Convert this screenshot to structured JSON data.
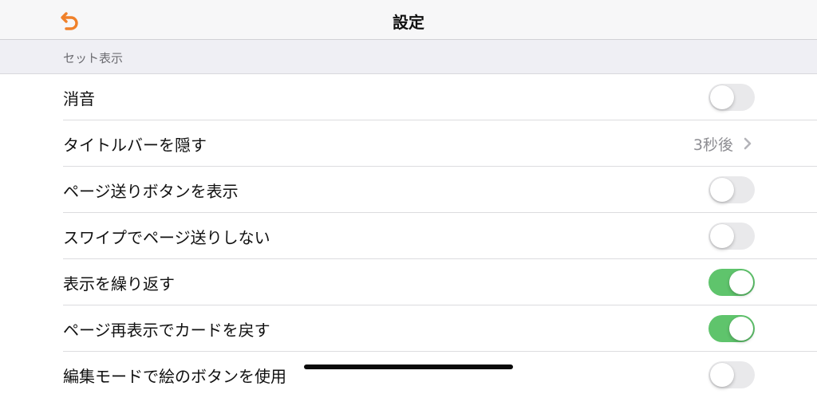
{
  "nav": {
    "title": "設定",
    "back_icon": "undo-arrow-icon",
    "accent_color": "#f0812a"
  },
  "section": {
    "header": "セット表示"
  },
  "rows": [
    {
      "label": "消音",
      "control": "toggle",
      "on": false
    },
    {
      "label": "タイトルバーを隠す",
      "control": "disclosure",
      "value": "3秒後"
    },
    {
      "label": "ページ送りボタンを表示",
      "control": "toggle",
      "on": false
    },
    {
      "label": "スワイプでページ送りしない",
      "control": "toggle",
      "on": false
    },
    {
      "label": "表示を繰り返す",
      "control": "toggle",
      "on": true
    },
    {
      "label": "ページ再表示でカードを戻す",
      "control": "toggle",
      "on": true
    },
    {
      "label": "編集モードで絵のボタンを使用",
      "control": "toggle",
      "on": false
    }
  ],
  "colors": {
    "toggle_on": "#5fc46c",
    "toggle_off": "#e9e9eb"
  }
}
